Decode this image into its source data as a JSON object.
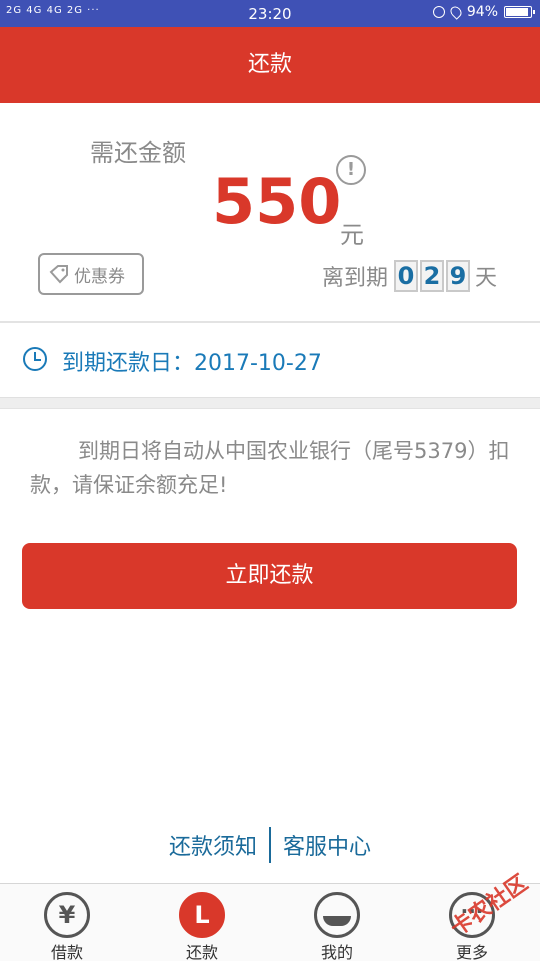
{
  "status_bar": {
    "signal_text": "2G 4G 4G 2G ···",
    "time": "23:20",
    "battery": "94%",
    "battery_level": 0.94
  },
  "header": {
    "title": "还款"
  },
  "amount_card": {
    "label": "需还金额",
    "amount": "550",
    "unit": "元",
    "info_icon": "!",
    "coupon_label": "优惠券",
    "countdown_label": "离到期",
    "countdown_digits": [
      "0",
      "2",
      "9"
    ],
    "countdown_unit": "天"
  },
  "due": {
    "text": "到期还款日：2017-10-27"
  },
  "notice": {
    "text": "到期日将自动从中国农业银行（尾号5379）扣款，请保证余额充足!"
  },
  "pay_button": {
    "label": "立即还款"
  },
  "footer_links": {
    "repay_notes": "还款须知",
    "service_center": "客服中心"
  },
  "tabbar": {
    "tabs": [
      {
        "label": "借款",
        "icon": "yen-icon",
        "glyph": "¥"
      },
      {
        "label": "还款",
        "icon": "repay-icon",
        "glyph": "L"
      },
      {
        "label": "我的",
        "icon": "profile-icon",
        "glyph": ""
      },
      {
        "label": "更多",
        "icon": "more-icon",
        "glyph": ""
      }
    ]
  },
  "watermark": "卡农社区",
  "colors": {
    "primary": "#d9382a",
    "link": "#1a7ab8",
    "status_bar": "#3f51b5"
  }
}
